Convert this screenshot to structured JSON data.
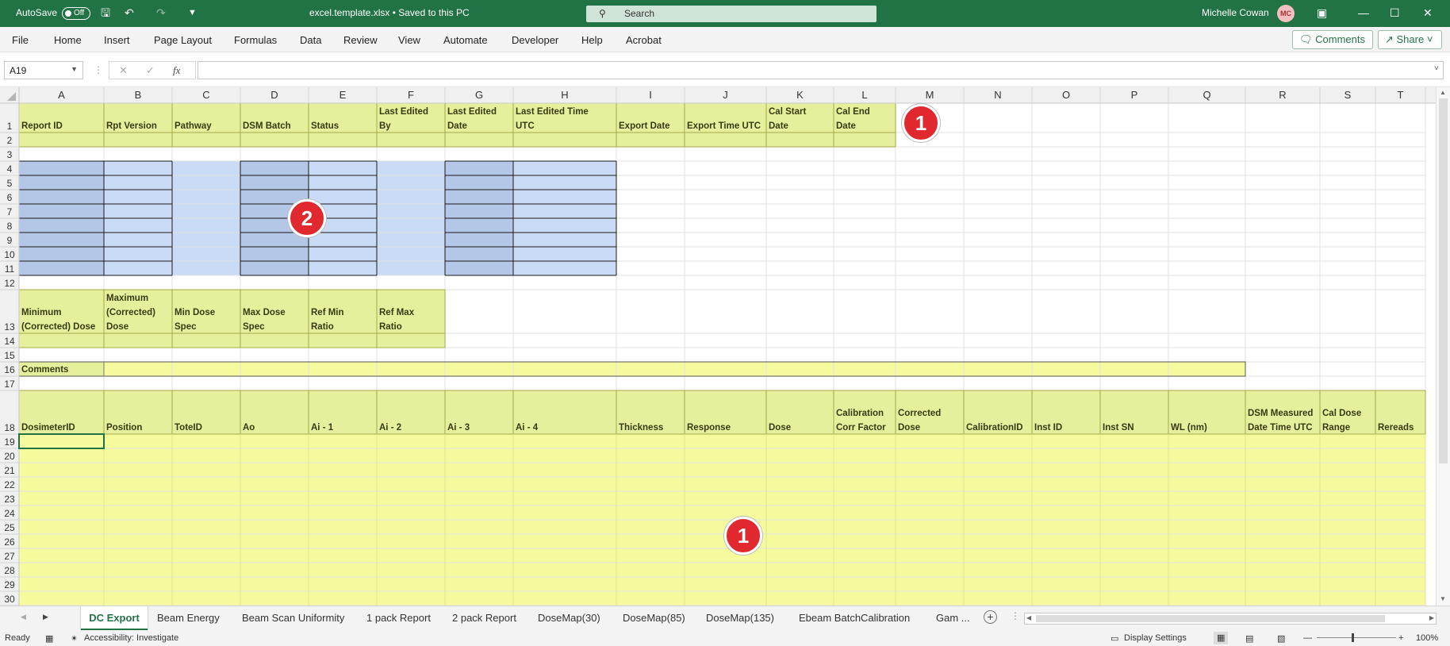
{
  "app": {
    "autosave_label": "AutoSave",
    "autosave_state": "Off",
    "title": "excel.template.xlsx  •  Saved to this PC",
    "search_placeholder": "Search",
    "user_name": "Michelle Cowan",
    "user_initials": "MC"
  },
  "menu": [
    "File",
    "Home",
    "Insert",
    "Page Layout",
    "Formulas",
    "Data",
    "Review",
    "View",
    "Automate",
    "Developer",
    "Help",
    "Acrobat"
  ],
  "buttons": {
    "comments": "Comments",
    "share": "Share"
  },
  "formula_bar": {
    "name_box": "A19",
    "fx_label": "fx",
    "value": ""
  },
  "columns": [
    "A",
    "B",
    "C",
    "D",
    "E",
    "F",
    "G",
    "H",
    "I",
    "J",
    "K",
    "L",
    "M",
    "N",
    "O",
    "P",
    "Q",
    "R",
    "S",
    "T"
  ],
  "rows": [
    "1",
    "2",
    "3",
    "4",
    "5",
    "6",
    "7",
    "8",
    "9",
    "10",
    "11",
    "12",
    "13",
    "14",
    "15",
    "16",
    "17",
    "18",
    "19",
    "20",
    "21",
    "22",
    "23",
    "24",
    "25",
    "26",
    "27",
    "28",
    "29",
    "30"
  ],
  "header_row1": [
    "Report ID",
    "Rpt Version",
    "Pathway",
    "DSM Batch",
    "Status",
    "Last Edited By",
    "Last Edited Date",
    "Last Edited Time UTC",
    "Export Date",
    "Export Time UTC",
    "Cal Start Date",
    "Cal End Date"
  ],
  "header_row13": [
    "Minimum (Corrected) Dose",
    "Maximum (Corrected) Dose",
    "Min Dose Spec",
    "Max Dose Spec",
    "Ref Min Ratio",
    "Ref Max Ratio"
  ],
  "comments_label": "Comments",
  "header_row18": [
    "DosimeterID",
    "Position",
    "ToteID",
    "Ao",
    "Ai - 1",
    "Ai - 2",
    "Ai - 3",
    "Ai - 4",
    "Thickness",
    "Response",
    "Dose",
    "Calibration Corr Factor",
    "Corrected Dose",
    "CalibrationID",
    "Inst ID",
    "Inst SN",
    "WL (nm)",
    "DSM Measured Date Time UTC",
    "Cal Dose Range",
    "Rereads"
  ],
  "markers": [
    "1",
    "2",
    "1"
  ],
  "sheet_tabs": [
    "DC Export",
    "Beam Energy",
    "Beam Scan Uniformity",
    "1 pack Report",
    "2 pack Report",
    "DoseMap(30)",
    "DoseMap(85)",
    "DoseMap(135)",
    "Ebeam BatchCalibration",
    "Gam ..."
  ],
  "active_tab": "DC Export",
  "status": {
    "ready": "Ready",
    "accessibility": "Accessibility: Investigate",
    "display_settings": "Display Settings",
    "zoom": "100%"
  },
  "colors": {
    "excel_green": "#217346",
    "header_fill": "#e6f09c",
    "data_fill": "#f5fb9c",
    "blue_light": "#c9dbf5",
    "blue_dark": "#b4c7e7",
    "marker_red": "#e0282e"
  }
}
